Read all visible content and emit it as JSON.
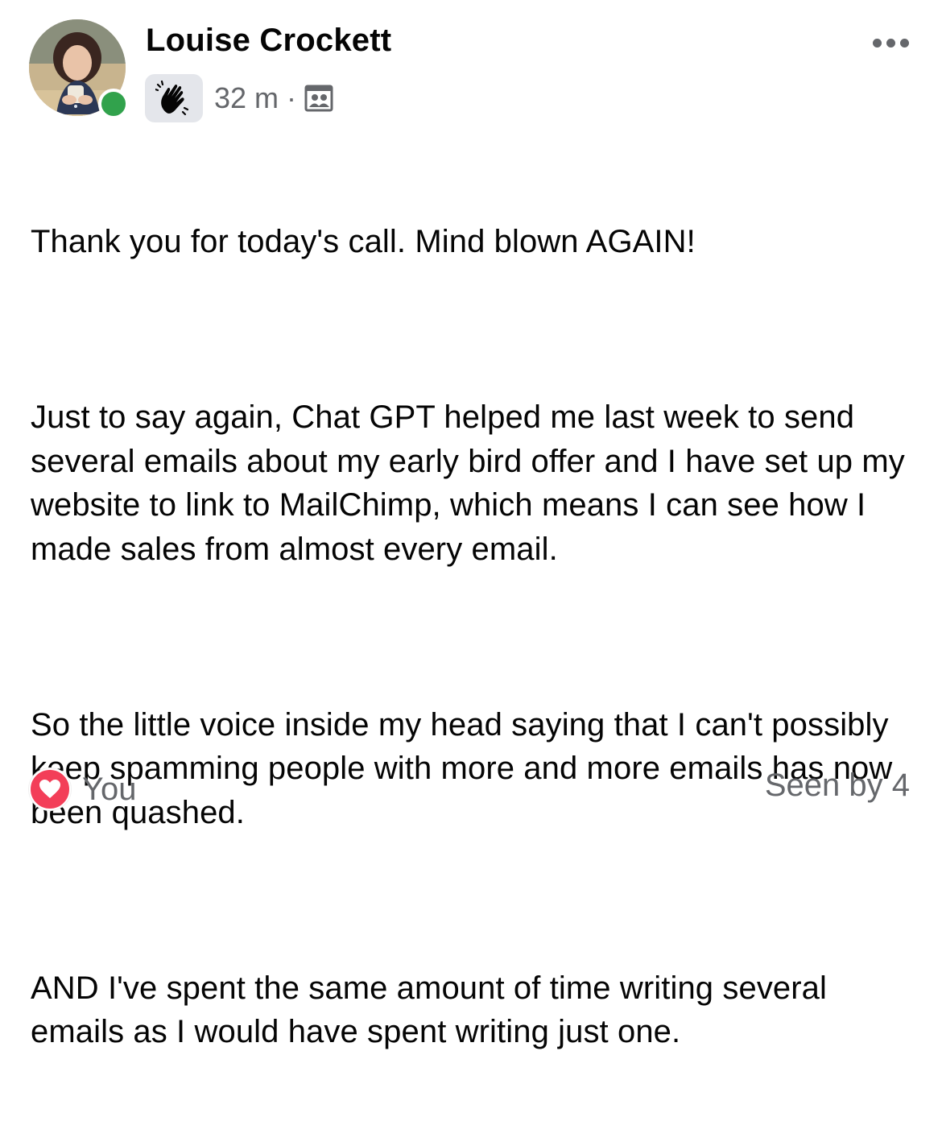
{
  "post": {
    "author": {
      "name": "Louise Crockett",
      "online": true
    },
    "meta": {
      "badge_icon": "wave-icon",
      "timestamp": "32 m",
      "separator": "·",
      "audience_icon": "group-members-icon"
    },
    "more_icon": "more-options-icon",
    "paragraphs": [
      "Thank you for today's call. Mind blown AGAIN!",
      "Just to say again, Chat GPT helped me last week to send several emails about my early bird offer and I have set up my website to link to MailChimp, which means I can see how I made sales from almost every email.",
      "So the little voice inside my head saying that I can't possibly keep spamming people with more and more emails has now been quashed.",
      "AND I've spent the same amount of time writing several emails as I would have spent writing just one."
    ],
    "reactions": {
      "icon": "heart-icon",
      "label": "You"
    },
    "seen_by": "Seen by 4"
  },
  "colors": {
    "text": "#050505",
    "secondary_text": "#65676b",
    "online": "#31a24c",
    "heart": "#f33e58",
    "badge_bg": "#e4e6eb"
  }
}
